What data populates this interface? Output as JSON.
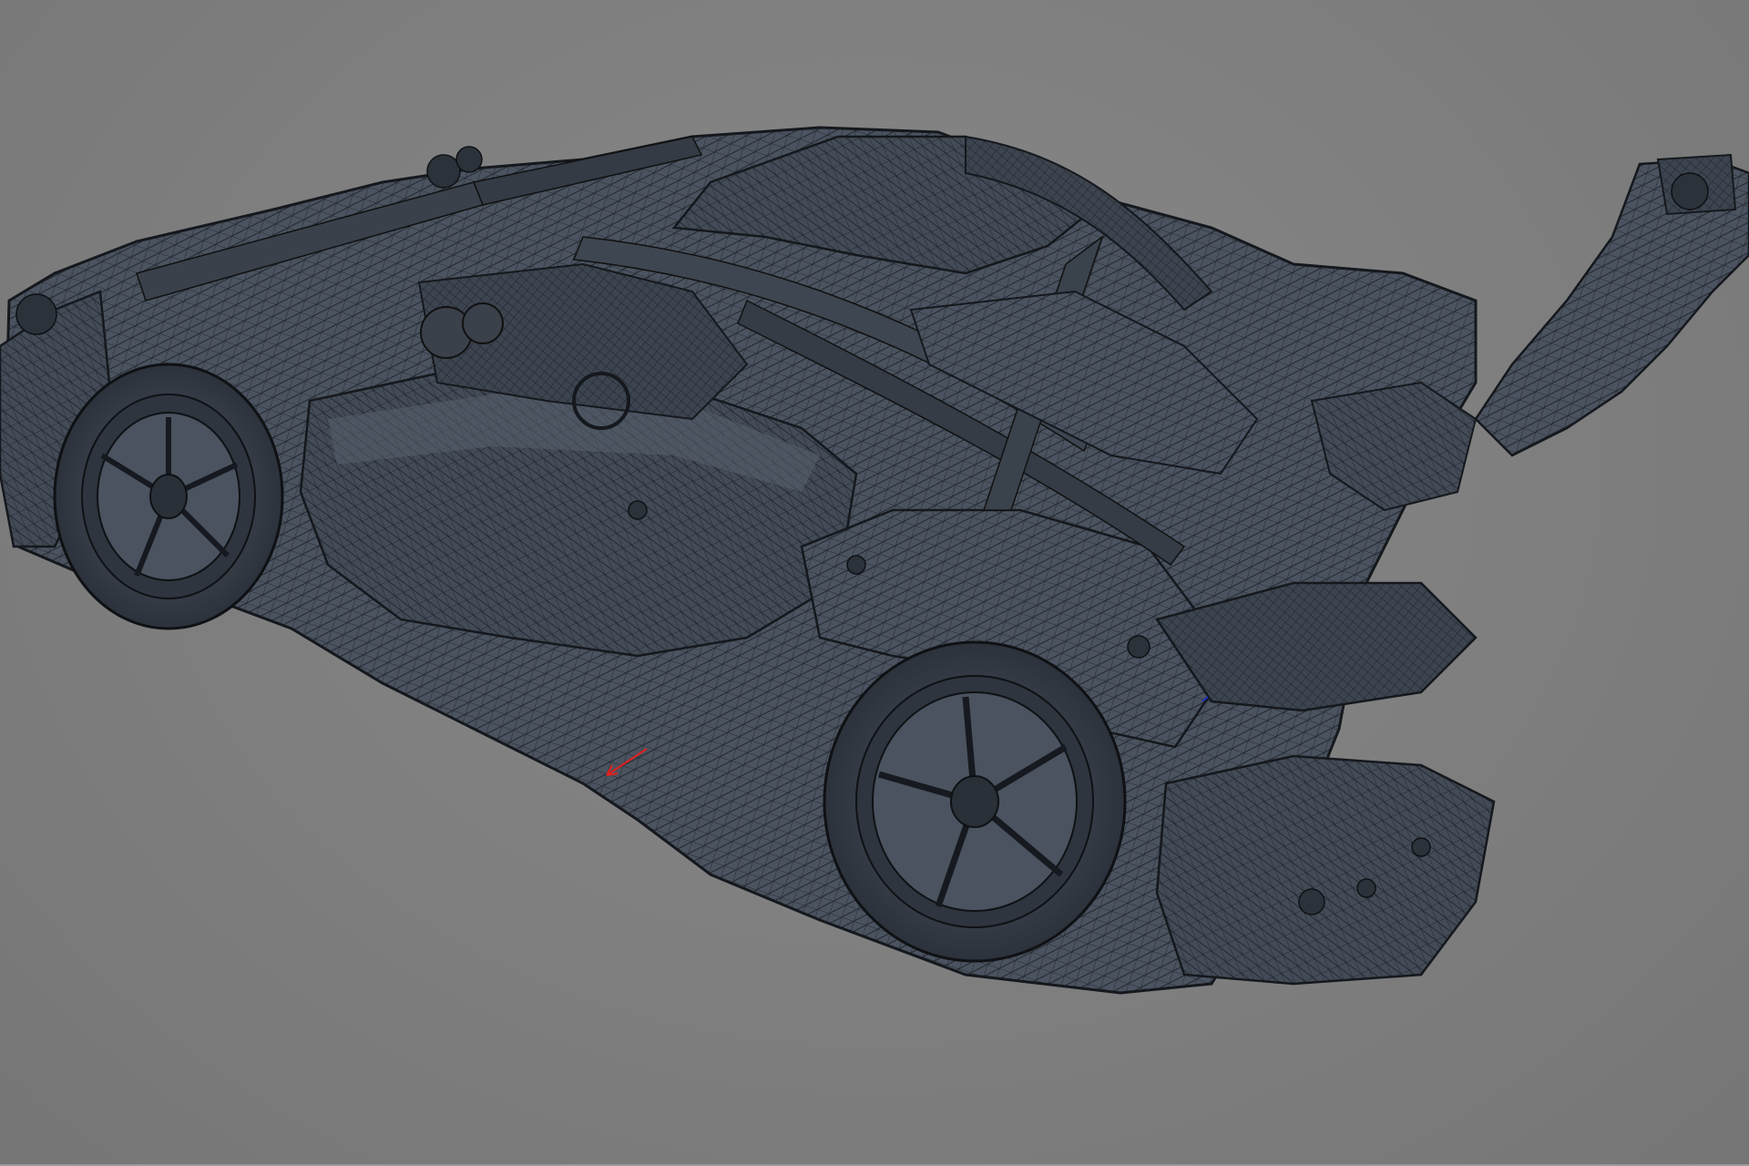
{
  "viewport": {
    "background_color": "#808080",
    "model": {
      "subject": "supercar-wireframe-model",
      "shading": "wireframe-on-shaded",
      "fill_color": "#434c58",
      "wire_color": "#1b1f26"
    },
    "axis_gizmo": {
      "x_axis_color": "#e02020",
      "y_axis_color": "#2030c0"
    }
  }
}
